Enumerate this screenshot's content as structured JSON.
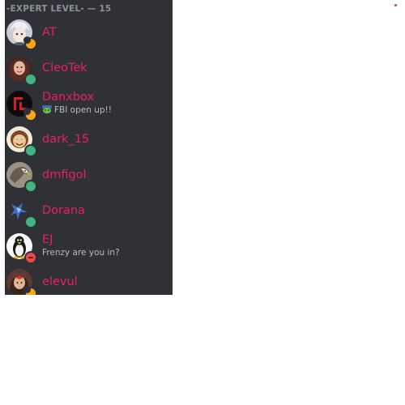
{
  "member_list": {
    "group_header": "-EXPERT LEVEL- — 15",
    "members": [
      {
        "name": "AT",
        "status": "idle",
        "avatar": "anime-avatar"
      },
      {
        "name": "CleoTek",
        "status": "online",
        "avatar": "woman-avatar"
      },
      {
        "name": "Danxbox",
        "status": "idle",
        "avatar": "red-logo-avatar",
        "activity": "FBI open up!!",
        "activity_icon": "emoji-icon"
      },
      {
        "name": "dark_15",
        "status": "online",
        "avatar": "cartoon-face-avatar"
      },
      {
        "name": "dmfigol",
        "status": "online",
        "avatar": "eagle-avatar"
      },
      {
        "name": "Dorana",
        "status": "online",
        "avatar": "blue-figure-avatar"
      },
      {
        "name": "EJ",
        "status": "dnd",
        "avatar": "penguin-avatar",
        "activity": "Frenzy are you in?"
      },
      {
        "name": "elevul",
        "status": "idle",
        "avatar": "character-avatar"
      }
    ]
  },
  "colors": {
    "panel_bg": "#2f3136",
    "name_color": "#e91e63",
    "online": "#43b581",
    "idle": "#faa61a",
    "dnd": "#f04747"
  }
}
